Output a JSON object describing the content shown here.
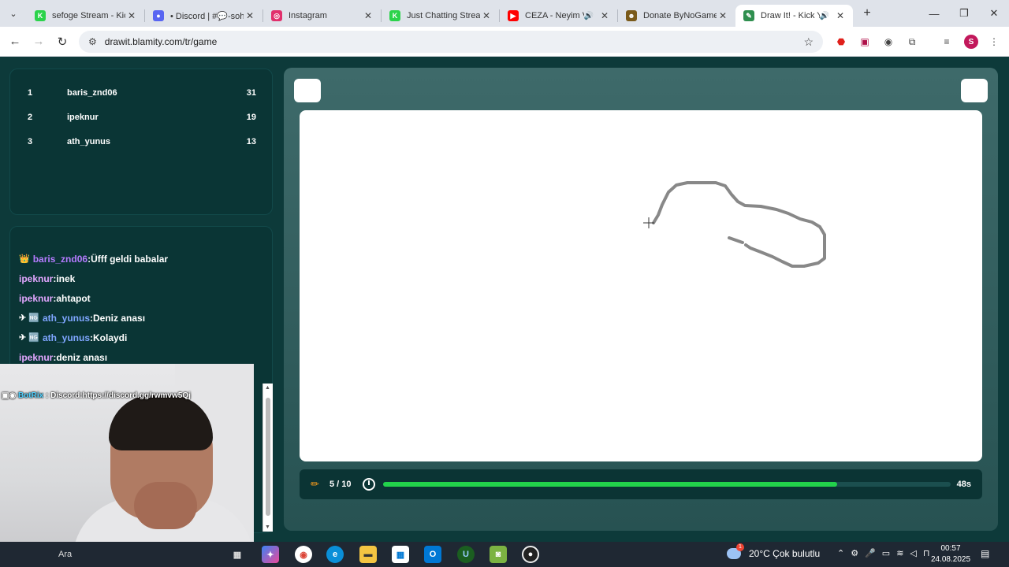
{
  "browser": {
    "tabs": [
      {
        "title": "sefoge Stream - Kick",
        "favicon": "kick-icon",
        "color": "#2bd34b",
        "glyph": "K",
        "active": false
      },
      {
        "title": "• Discord | #💬-sohb",
        "favicon": "discord-icon",
        "color": "#5865f2",
        "glyph": "●",
        "active": false
      },
      {
        "title": "Instagram",
        "favicon": "instagram-icon",
        "color": "#e1306c",
        "glyph": "◎",
        "active": false
      },
      {
        "title": "Just Chatting Stream",
        "favicon": "kick-icon",
        "color": "#2bd34b",
        "glyph": "K",
        "active": false
      },
      {
        "title": "CEZA - Neyim Va",
        "favicon": "youtube-icon",
        "color": "#ff0000",
        "glyph": "▶",
        "active": false,
        "audio": true
      },
      {
        "title": "Donate ByNoGame",
        "favicon": "bynogame-icon",
        "color": "#7a5a1a",
        "glyph": "☻",
        "active": false
      },
      {
        "title": "Draw It! - Kick Ya",
        "favicon": "drawit-icon",
        "color": "#2f8f4f",
        "glyph": "✎",
        "active": true,
        "audio": true
      }
    ],
    "url": "drawit.blamity.com/tr/game",
    "profile_initial": "S"
  },
  "leaderboard": [
    {
      "rank": "1",
      "name": "baris_znd06",
      "score": "31"
    },
    {
      "rank": "2",
      "name": "ipeknur",
      "score": "19"
    },
    {
      "rank": "3",
      "name": "ath_yunus",
      "score": "13"
    }
  ],
  "chat": [
    {
      "badge": "👑",
      "user": "baris_znd06",
      "sep": ":",
      "text": "Üfff geldi babalar",
      "color": "purple"
    },
    {
      "badge": "",
      "user": "ipeknur",
      "sep": ":",
      "text": "inek",
      "color": "pink"
    },
    {
      "badge": "",
      "user": "ipeknur",
      "sep": ":",
      "text": "ahtapot",
      "color": "pink"
    },
    {
      "badge": "✈ 🆖",
      "user": "ath_yunus",
      "sep": ":",
      "text": "Deniz anası",
      "color": "blue"
    },
    {
      "badge": "✈ 🆖",
      "user": "ath_yunus",
      "sep": ":",
      "text": "Kolaydi",
      "color": "blue"
    },
    {
      "badge": "",
      "user": "ipeknur",
      "sep": ":",
      "text": "deniz anası",
      "color": "pink"
    }
  ],
  "bot_message": {
    "user": "BotRix",
    "sep": " : ",
    "text": "Discord:https://discord.gg/rwmvw5Qj"
  },
  "game": {
    "round": "5 / 10",
    "time_left": "48s",
    "progress_percent": 80,
    "stroke_color": "#888888"
  },
  "taskbar": {
    "search": "Ara",
    "weather": "20°C  Çok bulutlu",
    "weather_badge": "1",
    "time": "00:57",
    "date": "24.08.2025"
  }
}
